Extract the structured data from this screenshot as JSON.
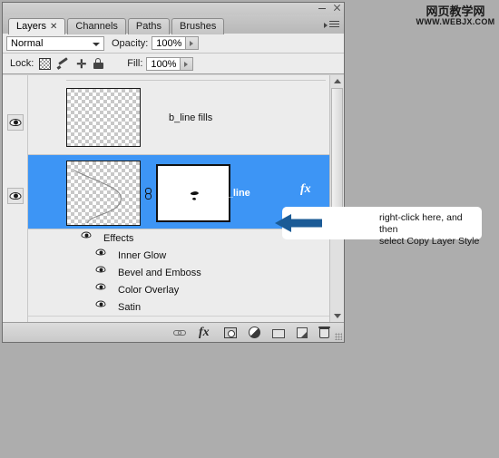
{
  "window": {
    "minimize_label": "minimize",
    "close_label": "close",
    "panel_menu_label": "panel menu"
  },
  "tabs": [
    {
      "label": "Layers",
      "active": true,
      "closable": true
    },
    {
      "label": "Channels",
      "active": false,
      "closable": false
    },
    {
      "label": "Paths",
      "active": false,
      "closable": false
    },
    {
      "label": "Brushes",
      "active": false,
      "closable": false
    }
  ],
  "blend_row": {
    "mode_value": "Normal",
    "opacity_label": "Opacity:",
    "opacity_value": "100%"
  },
  "lock_row": {
    "lock_label": "Lock:",
    "icons": [
      "lock-transparency-icon",
      "lock-image-icon",
      "lock-position-icon",
      "lock-all-icon"
    ],
    "fill_label": "Fill:",
    "fill_value": "100%"
  },
  "layers": [
    {
      "name": "b_line fills",
      "selected": false,
      "visible": true,
      "has_mask": false,
      "has_fx": false,
      "thumb": "transparent-checker"
    },
    {
      "name": "b_line",
      "selected": true,
      "visible": true,
      "has_mask": true,
      "has_fx": true,
      "fx_label": "fx",
      "thumb": "curve-on-transparent",
      "mask_thumb": "white-mask"
    }
  ],
  "effects": {
    "group_label": "Effects",
    "items": [
      {
        "label": "Inner Glow",
        "visible": true
      },
      {
        "label": "Bevel and Emboss",
        "visible": true
      },
      {
        "label": "Color Overlay",
        "visible": true
      },
      {
        "label": "Satin",
        "visible": true
      }
    ]
  },
  "bottom_toolbar": {
    "buttons": [
      "link-layers-icon",
      "layer-style-fx-icon",
      "add-layer-mask-icon",
      "new-adjustment-layer-icon",
      "new-group-icon",
      "new-layer-icon",
      "delete-layer-icon"
    ],
    "fx_label": "fx"
  },
  "callout": {
    "text": "right-click here, and then\nselect Copy Layer Style",
    "arrow_color": "#1b5b96",
    "box_color": "#ffffff"
  },
  "watermark": {
    "chinese": "网页教学网",
    "url": "WWW.WEBJX.COM"
  },
  "colors": {
    "selection_blue": "#3d95f5",
    "panel_bg": "#ececec",
    "desktop_bg": "#adadad"
  }
}
